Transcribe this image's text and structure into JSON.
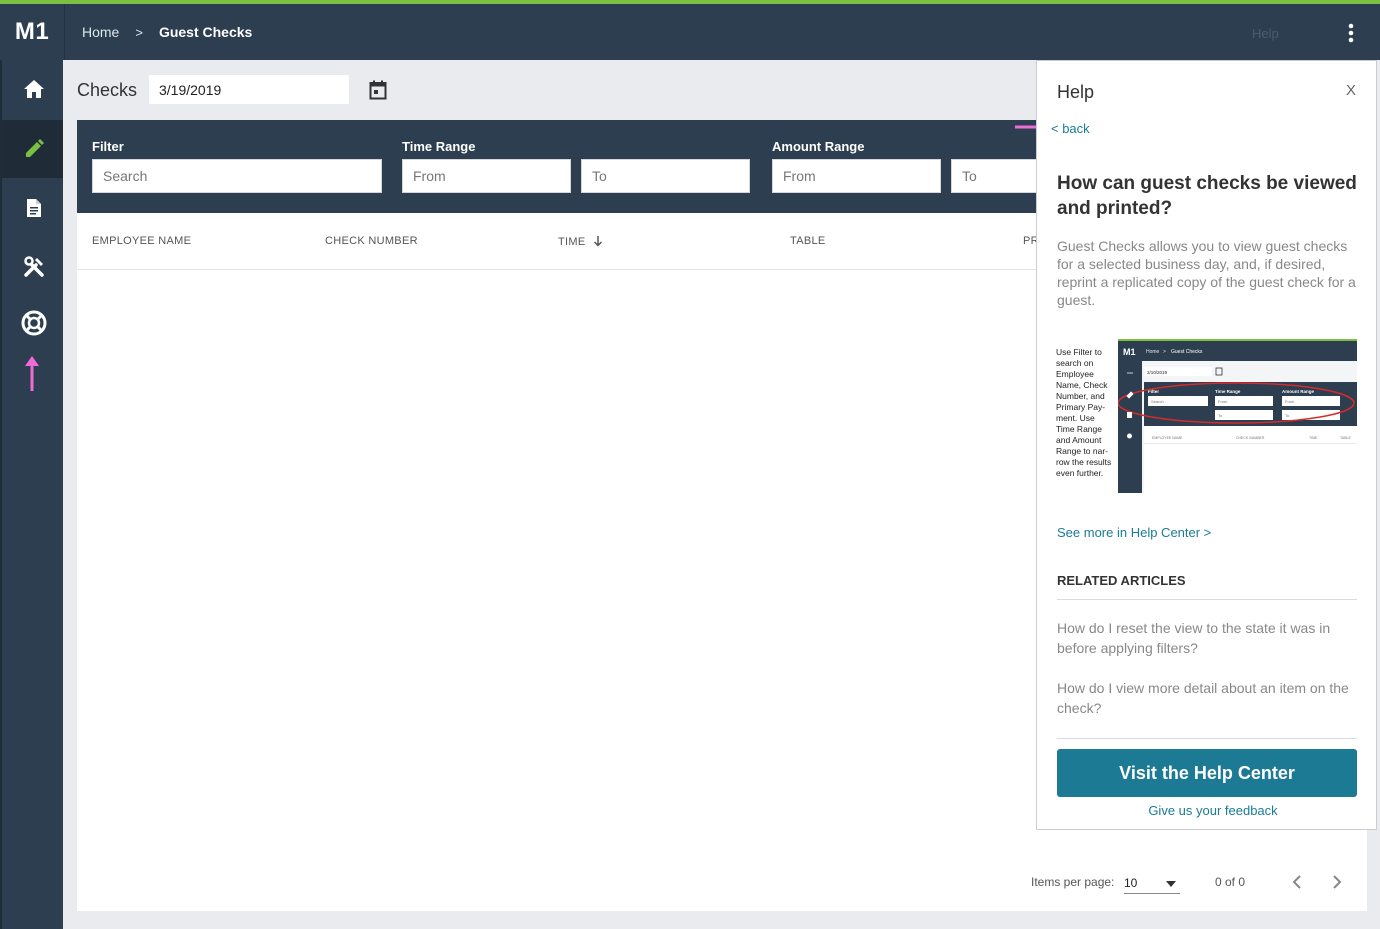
{
  "app": {
    "logo": "M1"
  },
  "breadcrumb": {
    "home": "Home",
    "separator": ">",
    "current": "Guest Checks"
  },
  "header": {
    "help_label": "Help"
  },
  "sidebar": {
    "items": [
      {
        "icon": "home-icon"
      },
      {
        "icon": "pencil-icon",
        "active": true
      },
      {
        "icon": "document-icon"
      },
      {
        "icon": "tools-icon"
      },
      {
        "icon": "lifebuoy-icon"
      }
    ]
  },
  "checks": {
    "label": "Checks",
    "date_value": "3/19/2019"
  },
  "filters": {
    "filter_label": "Filter",
    "filter_placeholder": "Search",
    "time_range_label": "Time Range",
    "time_from": "From",
    "time_to": "To",
    "amount_range_label": "Amount Range",
    "amount_from": "From",
    "amount_to": "To"
  },
  "table": {
    "columns": [
      "EMPLOYEE NAME",
      "CHECK NUMBER",
      "TIME",
      "TABLE",
      "PR"
    ]
  },
  "pagination": {
    "items_per_page_label": "Items per page:",
    "items_per_page_value": "10",
    "range": "0 of 0"
  },
  "help_panel": {
    "title": "Help",
    "close": "X",
    "back": "< back",
    "heading": "How can guest checks be viewed and printed?",
    "body": "Guest Checks allows you to view guest checks for a selected business day, and, if desired, reprint a replicated copy of the guest check for a guest.",
    "thumbnail_caption": "Use Filter to search on Employee Name, Check Number, and Primary Pay-ment. Use Time Range and Amount Range to nar-row the results even further.",
    "thumbnail": {
      "logo": "M1",
      "home": "Home",
      "sep": ">",
      "crumb": "Guest Checks",
      "date": "2/10/2019",
      "filter": "Filter",
      "time_range": "Time Range",
      "amount_range": "Amount Range",
      "search": "Search",
      "from": "From",
      "to": "To",
      "col1": "EMPLOYEE NAME",
      "col2": "CHECK NUMBER",
      "col3": "TIME",
      "col4": "TABLE"
    },
    "see_more": "See more in Help Center >",
    "related_title": "RELATED ARTICLES",
    "related": [
      "How do I reset the view to the state it was in before applying filters?",
      "How do I view more detail about an item on the check?"
    ],
    "visit_button": "Visit the Help Center",
    "feedback": "Give us your feedback"
  },
  "colors": {
    "nav_bg": "#2c3e50",
    "accent_green": "#7bc043",
    "teal": "#1c7a94",
    "annotation_pink": "#f06bd8"
  }
}
